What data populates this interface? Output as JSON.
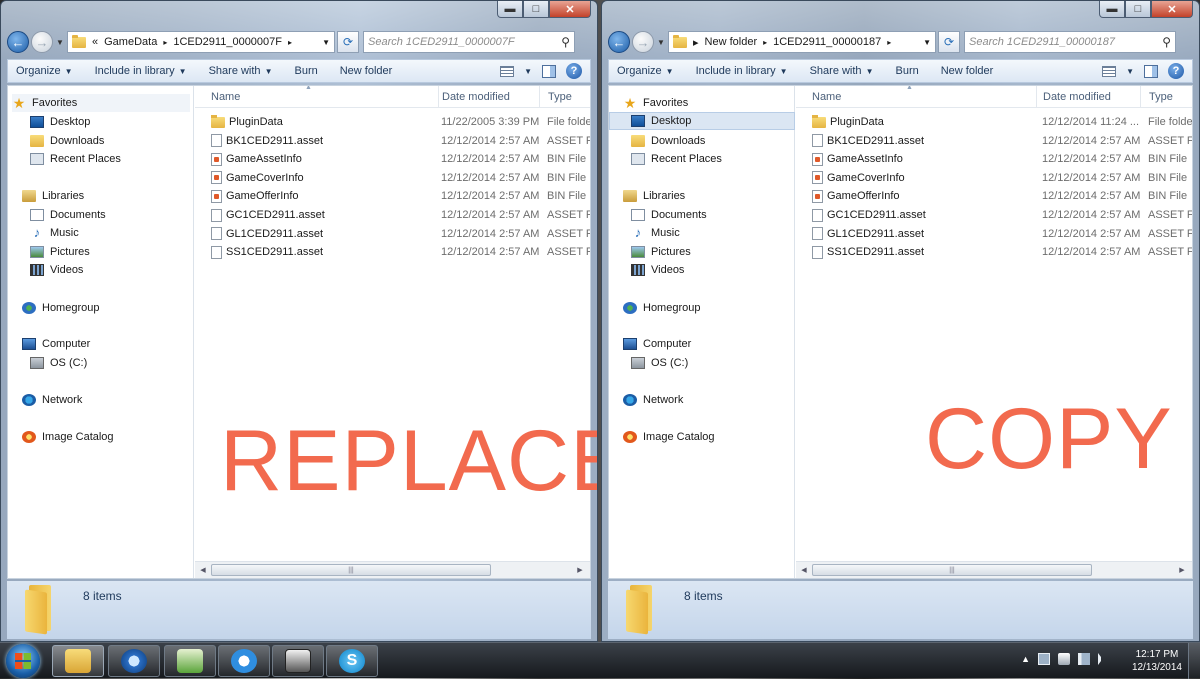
{
  "windows": {
    "left": {
      "breadcrumb": [
        "«",
        "GameData",
        "1CED2911_0000007F"
      ],
      "search_placeholder": "Search 1CED2911_0000007F",
      "overlay_text": "REPLACE",
      "status": "8 items",
      "files": [
        {
          "name": "PluginData",
          "date": "11/22/2005 3:39 PM",
          "type": "File folder",
          "icon": "folder-icon"
        },
        {
          "name": "BK1CED2911.asset",
          "date": "12/12/2014 2:57 AM",
          "type": "ASSET File",
          "icon": "file-icon"
        },
        {
          "name": "GameAssetInfo",
          "date": "12/12/2014 2:57 AM",
          "type": "BIN File",
          "icon": "bin-file-icon"
        },
        {
          "name": "GameCoverInfo",
          "date": "12/12/2014 2:57 AM",
          "type": "BIN File",
          "icon": "bin-file-icon"
        },
        {
          "name": "GameOfferInfo",
          "date": "12/12/2014 2:57 AM",
          "type": "BIN File",
          "icon": "bin-file-icon"
        },
        {
          "name": "GC1CED2911.asset",
          "date": "12/12/2014 2:57 AM",
          "type": "ASSET File",
          "icon": "file-icon"
        },
        {
          "name": "GL1CED2911.asset",
          "date": "12/12/2014 2:57 AM",
          "type": "ASSET File",
          "icon": "file-icon"
        },
        {
          "name": "SS1CED2911.asset",
          "date": "12/12/2014 2:57 AM",
          "type": "ASSET File",
          "icon": "file-icon"
        }
      ]
    },
    "right": {
      "breadcrumb": [
        "▸",
        "New folder",
        "1CED2911_00000187"
      ],
      "search_placeholder": "Search 1CED2911_00000187",
      "overlay_text": "COPY",
      "status": "8 items",
      "files": [
        {
          "name": "PluginData",
          "date": "12/12/2014 11:24 ...",
          "type": "File folder",
          "icon": "folder-icon"
        },
        {
          "name": "BK1CED2911.asset",
          "date": "12/12/2014 2:57 AM",
          "type": "ASSET File",
          "icon": "file-icon"
        },
        {
          "name": "GameAssetInfo",
          "date": "12/12/2014 2:57 AM",
          "type": "BIN File",
          "icon": "bin-file-icon"
        },
        {
          "name": "GameCoverInfo",
          "date": "12/12/2014 2:57 AM",
          "type": "BIN File",
          "icon": "bin-file-icon"
        },
        {
          "name": "GameOfferInfo",
          "date": "12/12/2014 2:57 AM",
          "type": "BIN File",
          "icon": "bin-file-icon"
        },
        {
          "name": "GC1CED2911.asset",
          "date": "12/12/2014 2:57 AM",
          "type": "ASSET File",
          "icon": "file-icon"
        },
        {
          "name": "GL1CED2911.asset",
          "date": "12/12/2014 2:57 AM",
          "type": "ASSET File",
          "icon": "file-icon"
        },
        {
          "name": "SS1CED2911.asset",
          "date": "12/12/2014 2:57 AM",
          "type": "ASSET File",
          "icon": "file-icon"
        }
      ]
    }
  },
  "toolbar": {
    "organize": "Organize",
    "include": "Include in library",
    "share": "Share with",
    "burn": "Burn",
    "new_folder": "New folder"
  },
  "columns": {
    "name": "Name",
    "date": "Date modified",
    "type": "Type"
  },
  "nav": {
    "favorites": "Favorites",
    "desktop": "Desktop",
    "downloads": "Downloads",
    "recent": "Recent Places",
    "libraries": "Libraries",
    "documents": "Documents",
    "music": "Music",
    "pictures": "Pictures",
    "videos": "Videos",
    "homegroup": "Homegroup",
    "computer": "Computer",
    "os": "OS (C:)",
    "network": "Network",
    "image_catalog": "Image Catalog"
  },
  "caption": {
    "minimize": "▬",
    "maximize": "□",
    "close": "✕"
  },
  "taskbar": {
    "apps": [
      "folder-icon",
      "itunes-icon",
      "ftp-icon",
      "ie-icon",
      "monitor-icon",
      "skype-icon"
    ],
    "time": "12:17 PM",
    "date": "12/13/2014"
  },
  "colors": {
    "overlay_text": "#f26a4e",
    "accent": "#1e395b",
    "selection": "#dbe6f3"
  }
}
